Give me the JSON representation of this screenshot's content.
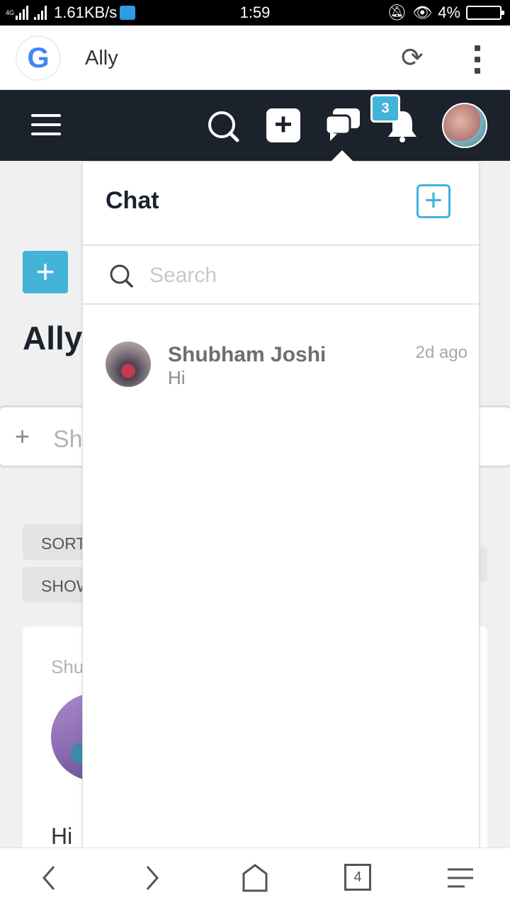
{
  "status_bar": {
    "network": "4G",
    "speed": "1.61KB/s",
    "time": "1:59",
    "battery": "4%"
  },
  "browser": {
    "title": "Ally"
  },
  "header": {
    "notification_count": "3"
  },
  "background_page": {
    "title": "Ally",
    "input_placeholder": "Sh",
    "sort_label": "SORT",
    "show_label": "SHOW",
    "post_author": "Shu",
    "post_text": "Hi"
  },
  "chat_panel": {
    "title": "Chat",
    "search_placeholder": "Search",
    "conversations": [
      {
        "name": "Shubham Joshi",
        "preview": "Hi",
        "time": "2d ago"
      }
    ]
  },
  "bottom_nav": {
    "tab_count": "4"
  }
}
